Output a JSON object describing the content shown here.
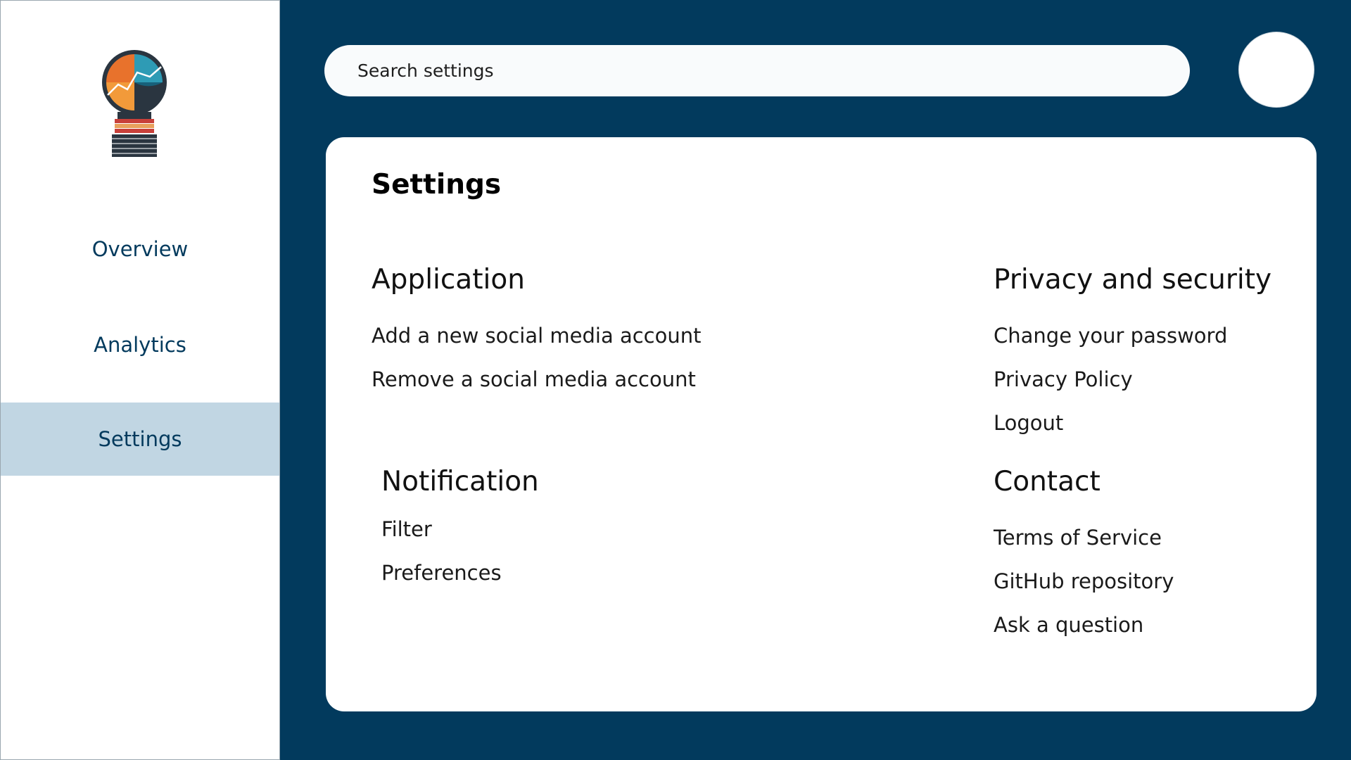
{
  "sidebar": {
    "logo_name": "lightbulb-chart-logo",
    "items": [
      {
        "label": "Overview"
      },
      {
        "label": "Analytics"
      },
      {
        "label": "Settings"
      }
    ],
    "active_item": "Settings"
  },
  "search": {
    "placeholder": "Search settings"
  },
  "main": {
    "title": "Settings",
    "sections": {
      "application": {
        "title": "Application",
        "links": [
          "Add a new social media account",
          "Remove a social media account"
        ]
      },
      "privacy": {
        "title": "Privacy and security",
        "links": [
          "Change your password",
          "Privacy Policy",
          "Logout"
        ]
      },
      "notification": {
        "title": "Notification",
        "links": [
          "Filter",
          "Preferences"
        ]
      },
      "contact": {
        "title": "Contact",
        "links": [
          "Terms of Service",
          "GitHub repository",
          "Ask a question"
        ]
      }
    }
  },
  "colors": {
    "background": "#023a5d",
    "sidebar_active": "#c1d6e3",
    "nav_text": "#023a5d"
  }
}
